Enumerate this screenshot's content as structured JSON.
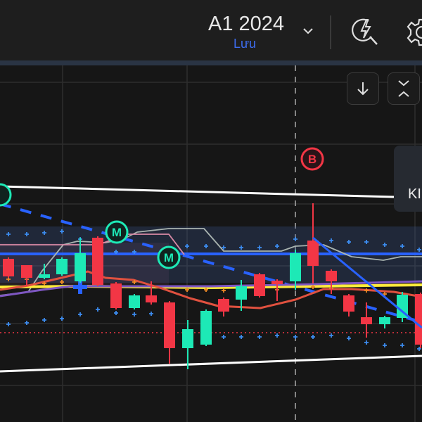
{
  "header": {
    "title": "A1 2024",
    "subtitle": "Lưu",
    "icons": [
      "chevron-down-icon",
      "quick-search-lightning-icon",
      "gear-icon"
    ]
  },
  "chart": {
    "markers": [
      "M",
      "M",
      "B"
    ],
    "tooltip_text": "KI",
    "buttons": [
      "scroll-to-latest-icon",
      "collapse-expand-icon"
    ]
  },
  "colors": {
    "up": "#1de9b6",
    "down": "#f23645",
    "accent_blue": "#2962ff",
    "background": "#161616"
  }
}
